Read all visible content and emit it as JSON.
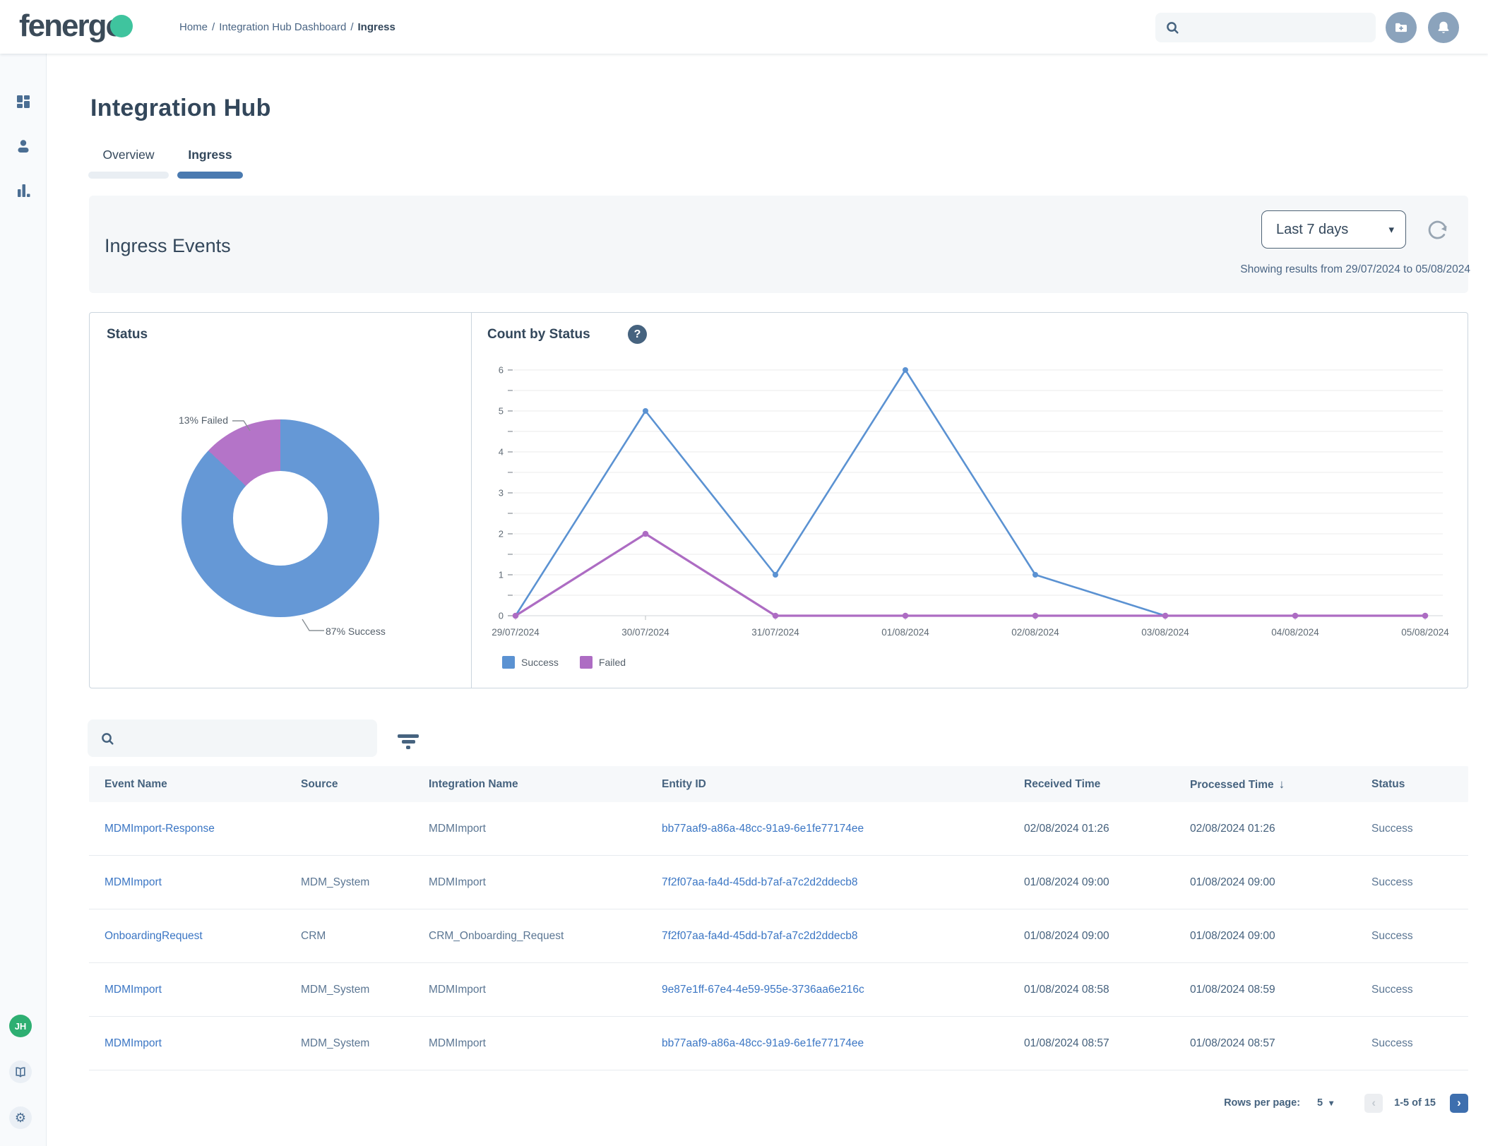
{
  "header": {
    "logo_text": "fenergo",
    "breadcrumb": {
      "home": "Home",
      "section": "Integration Hub Dashboard",
      "current": "Ingress",
      "separator": "/"
    }
  },
  "page": {
    "title": "Integration Hub",
    "tabs": [
      {
        "label": "Overview"
      },
      {
        "label": "Ingress"
      }
    ]
  },
  "ingress_events": {
    "title": "Ingress Events",
    "date_range_value": "Last 7 days",
    "showing_results": "Showing results from 29/07/2024 to 05/08/2024"
  },
  "status_card": {
    "title": "Status",
    "failed_label": "13% Failed",
    "success_label": "87% Success"
  },
  "count_card": {
    "title": "Count by Status",
    "help_icon": "?"
  },
  "chart_data": [
    {
      "type": "pie",
      "donut": true,
      "title": "Status",
      "labels": [
        "Success",
        "Failed"
      ],
      "values": [
        87,
        13
      ],
      "unit": "%",
      "colors": {
        "Success": "#6598d6",
        "Failed": "#b474c8"
      }
    },
    {
      "type": "line",
      "title": "Count by Status",
      "x": [
        "29/07/2024",
        "30/07/2024",
        "31/07/2024",
        "01/08/2024",
        "02/08/2024",
        "03/08/2024",
        "04/08/2024",
        "05/08/2024"
      ],
      "series": [
        {
          "name": "Success",
          "color": "#5b92d2",
          "values": [
            0,
            5,
            1,
            6,
            1,
            0,
            0,
            0
          ]
        },
        {
          "name": "Failed",
          "color": "#ad6cc3",
          "values": [
            0,
            2,
            0,
            0,
            0,
            0,
            0,
            0
          ]
        }
      ],
      "ylim": [
        0,
        6
      ],
      "yticks": [
        0,
        1,
        2,
        3,
        4,
        5,
        6
      ],
      "yminor_step": 0.5,
      "grid": true,
      "legend_position": "bottom-left"
    }
  ],
  "table": {
    "columns": [
      {
        "label": "Event Name"
      },
      {
        "label": "Source"
      },
      {
        "label": "Integration Name"
      },
      {
        "label": "Entity ID"
      },
      {
        "label": "Received Time"
      },
      {
        "label": "Processed Time",
        "sorted": "desc"
      },
      {
        "label": "Status"
      }
    ],
    "rows": [
      {
        "event_name": "MDMImport-Response",
        "source": "",
        "integration_name": "MDMImport",
        "entity_id": "bb77aaf9-a86a-48cc-91a9-6e1fe77174ee",
        "received_time": "02/08/2024 01:26",
        "processed_time": "02/08/2024 01:26",
        "status": "Success"
      },
      {
        "event_name": "MDMImport",
        "source": "MDM_System",
        "integration_name": "MDMImport",
        "entity_id": "7f2f07aa-fa4d-45dd-b7af-a7c2d2ddecb8",
        "received_time": "01/08/2024 09:00",
        "processed_time": "01/08/2024 09:00",
        "status": "Success"
      },
      {
        "event_name": "OnboardingRequest",
        "source": "CRM",
        "integration_name": "CRM_Onboarding_Request",
        "entity_id": "7f2f07aa-fa4d-45dd-b7af-a7c2d2ddecb8",
        "received_time": "01/08/2024 09:00",
        "processed_time": "01/08/2024 09:00",
        "status": "Success"
      },
      {
        "event_name": "MDMImport",
        "source": "MDM_System",
        "integration_name": "MDMImport",
        "entity_id": "9e87e1ff-67e4-4e59-955e-3736aa6e216c",
        "received_time": "01/08/2024 08:58",
        "processed_time": "01/08/2024 08:59",
        "status": "Success"
      },
      {
        "event_name": "MDMImport",
        "source": "MDM_System",
        "integration_name": "MDMImport",
        "entity_id": "bb77aaf9-a86a-48cc-91a9-6e1fe77174ee",
        "received_time": "01/08/2024 08:57",
        "processed_time": "01/08/2024 08:57",
        "status": "Success"
      }
    ],
    "pagination": {
      "rows_per_page_label": "Rows per page:",
      "rows_per_page": "5",
      "range": "1-5 of 15"
    }
  },
  "sidebar": {
    "avatar_initials": "JH"
  },
  "icons": {
    "caret_down": "▾",
    "chevron_left": "‹",
    "chevron_right": "›",
    "sort_desc": "↓",
    "gear": "⚙"
  },
  "colors": {
    "accent_blue": "#4a7ab0",
    "link_blue": "#3b76c4",
    "brand_teal": "#3fc49e",
    "avatar_green": "#2eaf72"
  }
}
